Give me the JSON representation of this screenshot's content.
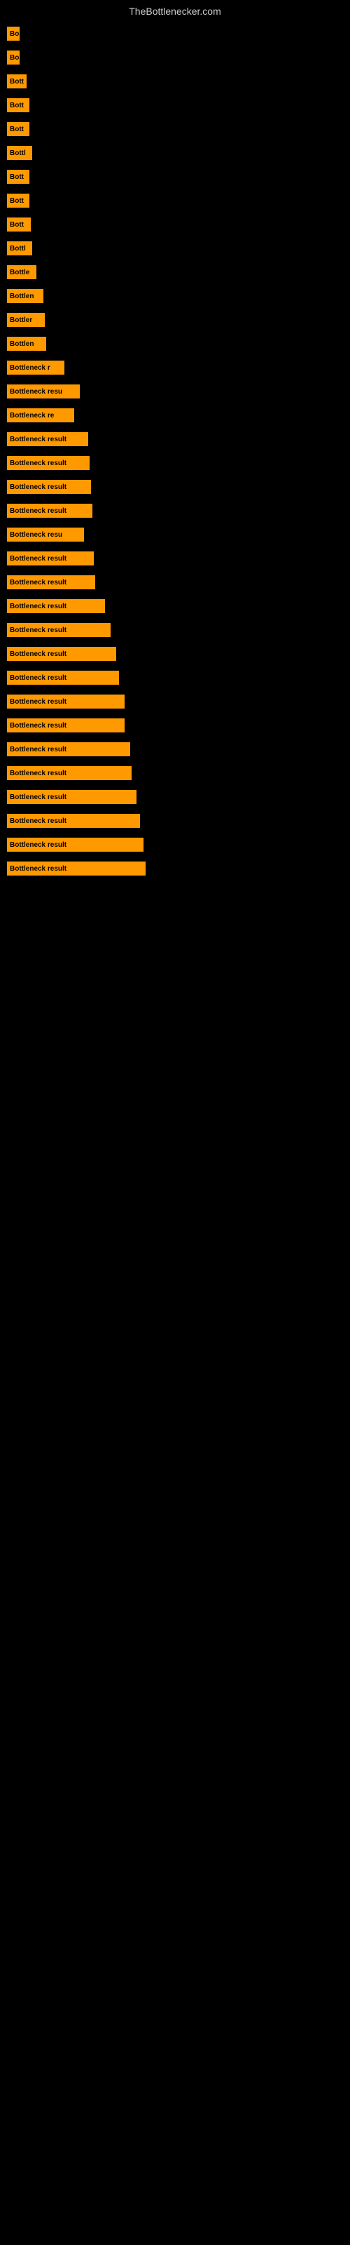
{
  "site": {
    "title": "TheBottlenecker.com"
  },
  "bars": [
    {
      "label": "Bo",
      "width": 18
    },
    {
      "label": "Bo",
      "width": 18
    },
    {
      "label": "Bott",
      "width": 28
    },
    {
      "label": "Bott",
      "width": 32
    },
    {
      "label": "Bott",
      "width": 32
    },
    {
      "label": "Bottl",
      "width": 36
    },
    {
      "label": "Bott",
      "width": 32
    },
    {
      "label": "Bott",
      "width": 32
    },
    {
      "label": "Bott",
      "width": 34
    },
    {
      "label": "Bottl",
      "width": 36
    },
    {
      "label": "Bottle",
      "width": 42
    },
    {
      "label": "Bottlen",
      "width": 52
    },
    {
      "label": "Bottler",
      "width": 54
    },
    {
      "label": "Bottlen",
      "width": 56
    },
    {
      "label": "Bottleneck r",
      "width": 82
    },
    {
      "label": "Bottleneck resu",
      "width": 104
    },
    {
      "label": "Bottleneck re",
      "width": 96
    },
    {
      "label": "Bottleneck result",
      "width": 116
    },
    {
      "label": "Bottleneck result",
      "width": 118
    },
    {
      "label": "Bottleneck result",
      "width": 120
    },
    {
      "label": "Bottleneck result",
      "width": 122
    },
    {
      "label": "Bottleneck resu",
      "width": 110
    },
    {
      "label": "Bottleneck result",
      "width": 124
    },
    {
      "label": "Bottleneck result",
      "width": 126
    },
    {
      "label": "Bottleneck result",
      "width": 140
    },
    {
      "label": "Bottleneck result",
      "width": 148
    },
    {
      "label": "Bottleneck result",
      "width": 156
    },
    {
      "label": "Bottleneck result",
      "width": 160
    },
    {
      "label": "Bottleneck result",
      "width": 168
    },
    {
      "label": "Bottleneck result",
      "width": 168
    },
    {
      "label": "Bottleneck result",
      "width": 176
    },
    {
      "label": "Bottleneck result",
      "width": 178
    },
    {
      "label": "Bottleneck result",
      "width": 185
    },
    {
      "label": "Bottleneck result",
      "width": 190
    },
    {
      "label": "Bottleneck result",
      "width": 195
    },
    {
      "label": "Bottleneck result",
      "width": 198
    }
  ]
}
